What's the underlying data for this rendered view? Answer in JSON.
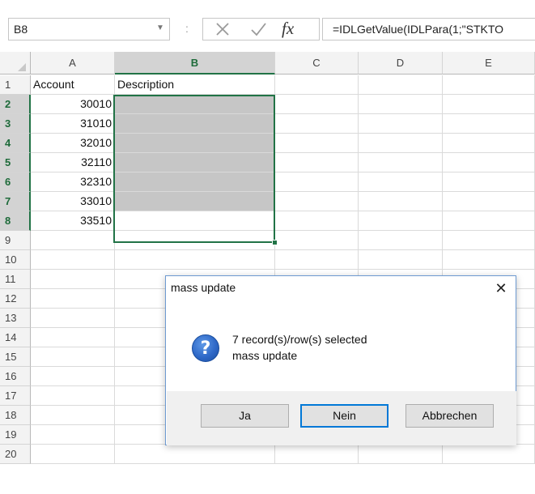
{
  "formula_bar": {
    "name_box": "B8",
    "separator": ":",
    "fx_label": "fx",
    "formula": "=IDLGetValue(IDLPara(1;\"STKTO"
  },
  "columns": [
    "A",
    "B",
    "C",
    "D",
    "E"
  ],
  "rows": [
    {
      "num": "1",
      "a": "Account",
      "b": "Description"
    },
    {
      "num": "2",
      "a": "30010",
      "b": ""
    },
    {
      "num": "3",
      "a": "31010",
      "b": ""
    },
    {
      "num": "4",
      "a": "32010",
      "b": ""
    },
    {
      "num": "5",
      "a": "32110",
      "b": ""
    },
    {
      "num": "6",
      "a": "32310",
      "b": ""
    },
    {
      "num": "7",
      "a": "33010",
      "b": ""
    },
    {
      "num": "8",
      "a": "33510",
      "b": ""
    },
    {
      "num": "9",
      "a": "",
      "b": ""
    },
    {
      "num": "10",
      "a": "",
      "b": ""
    },
    {
      "num": "11",
      "a": "",
      "b": ""
    },
    {
      "num": "12",
      "a": "",
      "b": ""
    },
    {
      "num": "13",
      "a": "",
      "b": ""
    },
    {
      "num": "14",
      "a": "",
      "b": ""
    },
    {
      "num": "15",
      "a": "",
      "b": ""
    },
    {
      "num": "16",
      "a": "",
      "b": ""
    },
    {
      "num": "17",
      "a": "",
      "b": ""
    },
    {
      "num": "18",
      "a": "",
      "b": ""
    },
    {
      "num": "19",
      "a": "",
      "b": ""
    },
    {
      "num": "20",
      "a": "",
      "b": ""
    }
  ],
  "selection": {
    "active_cell": "B8",
    "selected_rows": [
      "2",
      "3",
      "4",
      "5",
      "6",
      "7",
      "8"
    ],
    "selected_column": "B"
  },
  "dialog": {
    "title": "mass update",
    "close_glyph": "✕",
    "icon": "question-icon",
    "icon_glyph": "?",
    "message_line1": "7 record(s)/row(s) selected",
    "message_line2": "mass update",
    "buttons": {
      "yes": "Ja",
      "no": "Nein",
      "cancel": "Abbrechen"
    }
  },
  "colors": {
    "accent": "#217346",
    "highlight": "#c6c6c6",
    "dialog_border": "#6d9ad1",
    "focus": "#0078d7"
  }
}
